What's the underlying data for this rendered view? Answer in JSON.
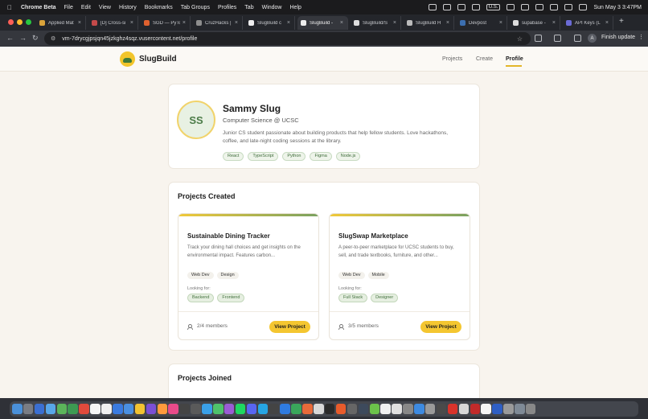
{
  "menubar": {
    "app_name": "Chrome Beta",
    "items": [
      "File",
      "Edit",
      "View",
      "History",
      "Bookmarks",
      "Tab Groups",
      "Profiles",
      "Tab",
      "Window",
      "Help"
    ],
    "input_source": "U.S.",
    "clock": "Sun May 3  3:47PM"
  },
  "tabs": [
    {
      "title": "Applied Mat",
      "color": "#d9a23a"
    },
    {
      "title": "[D] Cross-si",
      "color": "#c44a4a"
    },
    {
      "title": "SGD — PyTo",
      "color": "#e0612f"
    },
    {
      "title": "CruzHacks |",
      "color": "#8e8e8e"
    },
    {
      "title": "SlugBuild c",
      "color": "#eeeeee"
    },
    {
      "title": "SlugBuild -",
      "color": "#eeeeee"
    },
    {
      "title": "SlugBuild/S",
      "color": "#dddddd"
    },
    {
      "title": "SlugBuild H",
      "color": "#bbbbbb"
    },
    {
      "title": "Devpost",
      "color": "#3c6fb0"
    },
    {
      "title": "supabase -",
      "color": "#dddddd"
    },
    {
      "title": "API Keys (L",
      "color": "#6b6bd6"
    }
  ],
  "toolbar": {
    "url": "vm-7drycgjpsjqn45jzkghz4sqz.vusercontent.net/profile",
    "profile_initial": "A",
    "finish_update": "Finish update"
  },
  "site": {
    "logo_text": "SlugBuild",
    "nav": [
      "Projects",
      "Create",
      "Profile"
    ],
    "accent": "#f4c630",
    "green": "#3e6b3a"
  },
  "profile": {
    "initials": "SS",
    "name": "Sammy Slug",
    "major": "Computer Science @ UCSC",
    "bio": "Junior CS student passionate about building products that help fellow students. Love hackathons, coffee, and late-night coding sessions at the library.",
    "skills": [
      "React",
      "TypeScript",
      "Python",
      "Figma",
      "Node.js"
    ]
  },
  "projects_created": {
    "title": "Projects Created",
    "projects": [
      {
        "title": "Sustainable Dining Tracker",
        "description": "Track your dining hall choices and get insights on the environmental impact. Features carbon...",
        "tags": [
          "Web Dev",
          "Design"
        ],
        "looking_for_label": "Looking for:",
        "needs": [
          "Backend",
          "Frontend"
        ],
        "members": "2/4 members",
        "button": "View Project"
      },
      {
        "title": "SlugSwap Marketplace",
        "description": "A peer-to-peer marketplace for UCSC students to buy, sell, and trade textbooks, furniture, and other...",
        "tags": [
          "Web Dev",
          "Mobile"
        ],
        "looking_for_label": "Looking for:",
        "needs": [
          "Full Stack",
          "Designer"
        ],
        "members": "3/5 members",
        "button": "View Project"
      }
    ]
  },
  "projects_joined": {
    "title": "Projects Joined"
  }
}
